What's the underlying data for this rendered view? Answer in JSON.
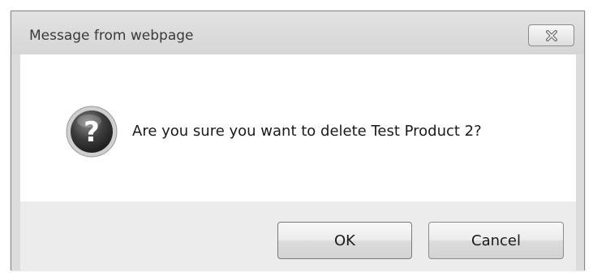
{
  "dialog": {
    "title": "Message from webpage",
    "close_icon": "close-x-icon",
    "message_icon": "question-mark-icon",
    "message": "Are you sure you want to delete Test Product 2?",
    "buttons": {
      "ok_label": "OK",
      "cancel_label": "Cancel"
    }
  }
}
